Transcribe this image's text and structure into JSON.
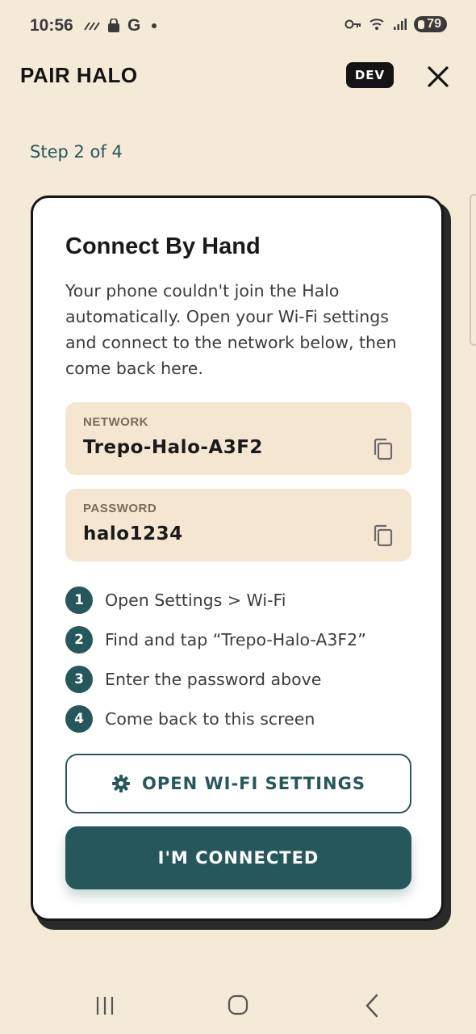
{
  "status_bar": {
    "time": "10:56",
    "left_icons": [
      "signal-strength-icon",
      "shopping-bag-icon",
      "google-g-icon",
      "dot-icon"
    ],
    "g_label": "G",
    "battery": "79"
  },
  "header": {
    "title": "PAIR HALO",
    "badge": "DEV"
  },
  "step_indicator": "Step 2 of 4",
  "card": {
    "title": "Connect By Hand",
    "description": "Your phone couldn't join the Halo automatically. Open your Wi-Fi settings and connect to the network below, then come back here.",
    "network": {
      "label": "NETWORK",
      "value": "Trepo-Halo-A3F2"
    },
    "password": {
      "label": "PASSWORD",
      "value": "halo1234"
    },
    "steps": [
      {
        "num": "1",
        "text": "Open Settings > Wi-Fi"
      },
      {
        "num": "2",
        "text": "Find and tap “Trepo-Halo-A3F2”"
      },
      {
        "num": "3",
        "text": "Enter the password above"
      },
      {
        "num": "4",
        "text": "Come back to this screen"
      }
    ],
    "open_settings_label": "OPEN WI-FI SETTINGS",
    "connected_label": "I'M CONNECTED"
  },
  "colors": {
    "background": "#f5e9d8",
    "accent": "#26575a",
    "field_bg": "#f5e6d2"
  }
}
